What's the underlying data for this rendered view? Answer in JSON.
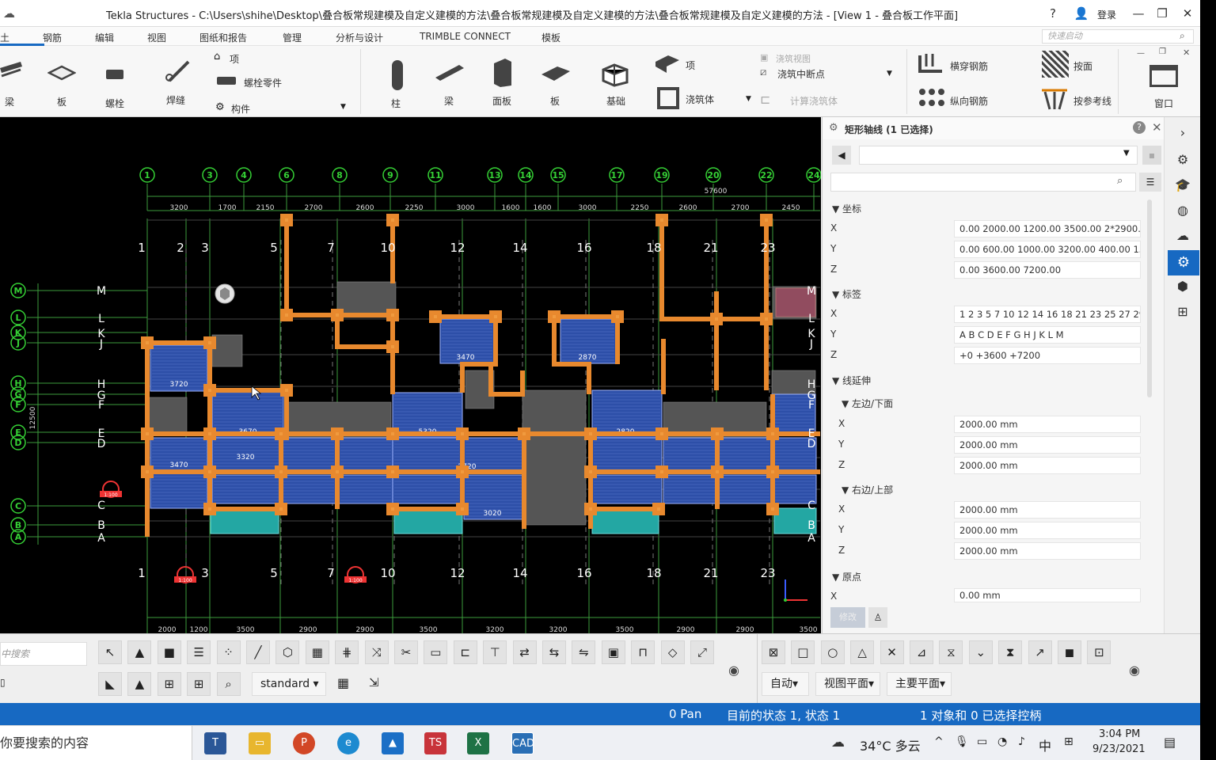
{
  "title": "Tekla Structures - C:\\Users\\shihe\\Desktop\\叠合板常规建模及自定义建模的方法\\叠合板常规建模及自定义建模的方法\\叠合板常规建模及自定义建模的方法 - [View 1 - 叠合板工作平面]",
  "titlebar": {
    "help": "?",
    "user_icon": "person-icon",
    "login": "登录",
    "min": "—",
    "max": "❐",
    "close": "✕"
  },
  "menu": [
    "土",
    "钢筋",
    "编辑",
    "视图",
    "图纸和报告",
    "管理",
    "分析与设计",
    "TRIMBLE CONNECT",
    "模板"
  ],
  "quick_launch": "快速启动",
  "ribbon": {
    "beam_left": "梁",
    "slab_left": "板",
    "bolt": "螺栓",
    "weld": "焊缝",
    "item_small": "项",
    "bolt_part": "螺栓零件",
    "component": "构件",
    "column": "柱",
    "beam": "梁",
    "panel": "面板",
    "slab": "板",
    "foundation": "基础",
    "item": "项",
    "pour": "浇筑体",
    "pour_view": "浇筑视图",
    "pour_break": "浇筑中断点",
    "calc_pour": "计算浇筑体",
    "cross_bar": "横穿钢筋",
    "long_bar": "纵向钢筋",
    "by_face": "按面",
    "by_ref": "按参考线",
    "window": "窗口"
  },
  "canvas": {
    "bubbles_top": [
      "1",
      "3",
      "4",
      "6",
      "8",
      "9",
      "11",
      "13",
      "14",
      "15",
      "17",
      "19",
      "20",
      "22",
      "24"
    ],
    "overall_dim": "57600",
    "top_dims": [
      "3200",
      "1700",
      "2150",
      "2700",
      "2600",
      "2250",
      "3000",
      "1600",
      "1600",
      "3000",
      "2250",
      "2600",
      "2700",
      "2450"
    ],
    "grid_nums_upper": [
      "1",
      "2",
      "3",
      "5",
      "7",
      "10",
      "12",
      "14",
      "16",
      "18",
      "21",
      "23"
    ],
    "grid_nums_lower": [
      "1",
      "3",
      "5",
      "7",
      "10",
      "12",
      "14",
      "16",
      "18",
      "21",
      "23"
    ],
    "bottom_dims": [
      "2000",
      "1200",
      "3500",
      "2900",
      "2900",
      "3500",
      "3200",
      "3200",
      "3500",
      "2900",
      "2900",
      "3500"
    ],
    "row_bubbles": [
      "M",
      "L",
      "K",
      "J",
      "H",
      "G",
      "F",
      "E",
      "D",
      "C",
      "B",
      "A"
    ],
    "row_letters": [
      "M",
      "L",
      "K",
      "J",
      "H",
      "G",
      "F",
      "E",
      "D",
      "C",
      "B",
      "A"
    ],
    "side_dim_total": "12500",
    "slab_labels": [
      "3720",
      "3670",
      "5320",
      "3470",
      "2870",
      "2820",
      "3470",
      "3320",
      "2720",
      "3020"
    ],
    "marker_label": "1:100"
  },
  "props": {
    "header": "矩形轴线 (1 已选择)",
    "sections": {
      "coord": "坐标",
      "labels": "标签",
      "extension": "线延伸",
      "left_bottom": "左边/下面",
      "right_top": "右边/上部",
      "origin": "原点"
    },
    "coord": {
      "x": "0.00 2000.00 1200.00 3500.00 2*2900.00",
      "y": "0.00 600.00 1000.00 3200.00 400.00 150",
      "z": "0.00 3600.00 7200.00"
    },
    "labels": {
      "x": "1 2 3 5 7 10 12 14 16 18 21 23 25 27 29",
      "y": "A B C D E F G H J K L M",
      "z": "+0 +3600 +7200"
    },
    "left_bottom": {
      "x": "2000.00 mm",
      "y": "2000.00 mm",
      "z": "2000.00 mm"
    },
    "right_top": {
      "x": "2000.00 mm",
      "y": "2000.00 mm",
      "z": "2000.00 mm"
    },
    "origin": {
      "x": "0.00 mm"
    },
    "modify": "修改",
    "axis": {
      "x": "X",
      "y": "Y",
      "z": "Z"
    }
  },
  "bottom": {
    "search_placeholder": "中搜索",
    "standard": "standard",
    "auto": "自动",
    "view_plane": "视图平面",
    "main_plane": "主要平面"
  },
  "status": {
    "pan": "0 Pan",
    "state": "目前的状态 1, 状态 1",
    "selection": "1 对象和 0 已选择控柄"
  },
  "taskbar": {
    "search": "你要搜索的内容",
    "weather": "34°C  多云",
    "lang": "中",
    "time": "3:04 PM",
    "date": "9/23/2021"
  },
  "colors": {
    "status_blue": "#1769c2",
    "canvas": "#000000",
    "beam_orange": "#e8892e",
    "slab_blue": "#2d4fa8",
    "grid_green": "#32c832"
  }
}
